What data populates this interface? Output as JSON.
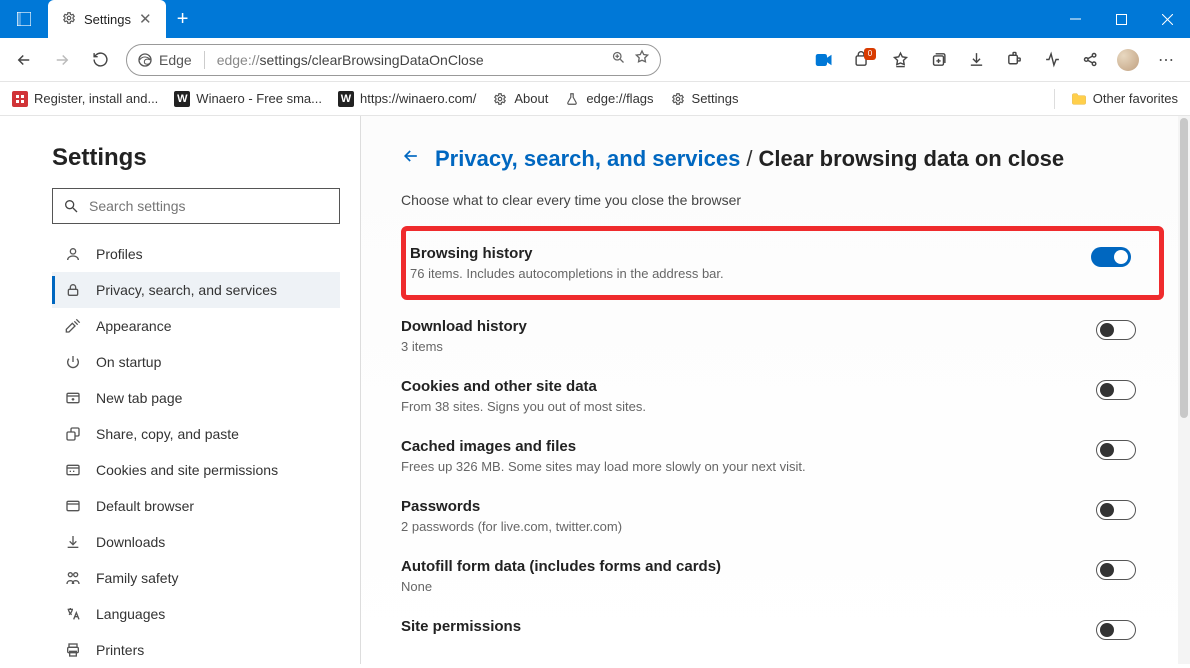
{
  "titlebar": {
    "tab_label": "Settings",
    "tab_icon": "gear-icon"
  },
  "toolbar": {
    "identity_label": "Edge",
    "url_prefix": "edge://",
    "url_path": "settings/clearBrowsingDataOnClose"
  },
  "bookmarks": [
    {
      "icon": "grid-red",
      "label": "Register, install and..."
    },
    {
      "icon": "w-dark",
      "label": "Winaero - Free sma..."
    },
    {
      "icon": "w-dark",
      "label": "https://winaero.com/"
    },
    {
      "icon": "gear",
      "label": "About"
    },
    {
      "icon": "flask",
      "label": "edge://flags"
    },
    {
      "icon": "gear",
      "label": "Settings"
    }
  ],
  "other_favorites_label": "Other favorites",
  "sidebar": {
    "heading": "Settings",
    "search_placeholder": "Search settings",
    "items": [
      {
        "icon": "profile",
        "label": "Profiles"
      },
      {
        "icon": "lock",
        "label": "Privacy, search, and services",
        "active": true
      },
      {
        "icon": "appearance",
        "label": "Appearance"
      },
      {
        "icon": "power",
        "label": "On startup"
      },
      {
        "icon": "newtab",
        "label": "New tab page"
      },
      {
        "icon": "share",
        "label": "Share, copy, and paste"
      },
      {
        "icon": "cookies",
        "label": "Cookies and site permissions"
      },
      {
        "icon": "browser",
        "label": "Default browser"
      },
      {
        "icon": "download",
        "label": "Downloads"
      },
      {
        "icon": "family",
        "label": "Family safety"
      },
      {
        "icon": "lang",
        "label": "Languages"
      },
      {
        "icon": "printer",
        "label": "Printers"
      }
    ]
  },
  "main": {
    "breadcrumb_link": "Privacy, search, and services",
    "breadcrumb_sep": "/",
    "breadcrumb_current": "Clear browsing data on close",
    "subtitle": "Choose what to clear every time you close the browser",
    "options": [
      {
        "title": "Browsing history",
        "desc": "76 items. Includes autocompletions in the address bar.",
        "on": true,
        "highlight": true
      },
      {
        "title": "Download history",
        "desc": "3 items",
        "on": false
      },
      {
        "title": "Cookies and other site data",
        "desc": "From 38 sites. Signs you out of most sites.",
        "on": false
      },
      {
        "title": "Cached images and files",
        "desc": "Frees up 326 MB. Some sites may load more slowly on your next visit.",
        "on": false
      },
      {
        "title": "Passwords",
        "desc": "2 passwords (for live.com, twitter.com)",
        "on": false
      },
      {
        "title": "Autofill form data (includes forms and cards)",
        "desc": "None",
        "on": false
      },
      {
        "title": "Site permissions",
        "desc": "",
        "on": false
      }
    ]
  }
}
